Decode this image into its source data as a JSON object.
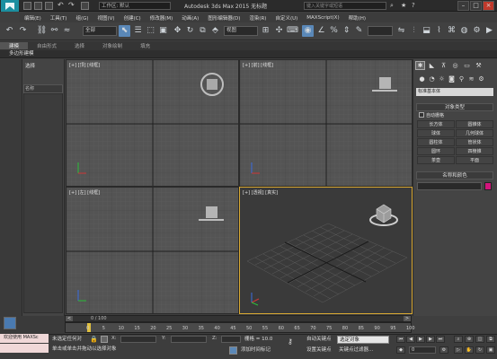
{
  "titlebar": {
    "workspace_label": "工作区: 默认",
    "app_title": "Autodesk 3ds Max  2015     无标题",
    "search_placeholder": "键入关键字或短语"
  },
  "menubar": {
    "items": [
      "编辑(E)",
      "工具(T)",
      "组(G)",
      "视图(V)",
      "创建(C)",
      "修改器(M)",
      "动画(A)",
      "图形编辑器(D)",
      "渲染(R)",
      "自定义(U)",
      "MAXScript(X)",
      "帮助(H)"
    ]
  },
  "toolbar": {
    "selection_filter": "全部",
    "ref_coord": "视图",
    "named_selection": ""
  },
  "ribbon": {
    "tabs": [
      "建模",
      "自由形式",
      "选择",
      "对象绘制",
      "填充"
    ],
    "subtab": "多边形建模"
  },
  "explorer": {
    "select_label": "选择",
    "name_header": "名称"
  },
  "viewports": {
    "top": "[+] [顶] [线框]",
    "front": "[+] [前] [线框]",
    "left": "[+] [左] [线框]",
    "perspective": "[+] [透视] [真实]"
  },
  "command_panel": {
    "object_category": "标准基本体",
    "object_type_header": "对象类型",
    "autogrid_label": "自动栅格",
    "object_buttons": [
      "长方体",
      "圆锥体",
      "球体",
      "几何球体",
      "圆柱体",
      "管状体",
      "圆环",
      "四棱锥",
      "茶壶",
      "平面"
    ],
    "name_color_header": "名称和颜色",
    "object_color": "#d2147c"
  },
  "timeline": {
    "frame_counter": "0 / 100",
    "ticks": [
      "0",
      "5",
      "10",
      "15",
      "20",
      "25",
      "30",
      "35",
      "40",
      "45",
      "50",
      "55",
      "60",
      "65",
      "70",
      "75",
      "80",
      "85",
      "90",
      "95",
      "100"
    ]
  },
  "statusbar": {
    "maxscript_label": "欢迎使用 MAXSc",
    "selection_status": "未选定任何对",
    "prompt": "单击或单击并拖动以选择对象",
    "x_label": "X:",
    "y_label": "Y:",
    "z_label": "Z:",
    "grid_label": "栅格 = 10.0",
    "add_time_tag": "添加时间标记",
    "auto_key": "自动关键点",
    "set_key": "设置关键点",
    "selected_set": "选定对象",
    "key_filters": "关键点过滤器...",
    "frame_value": "0"
  }
}
